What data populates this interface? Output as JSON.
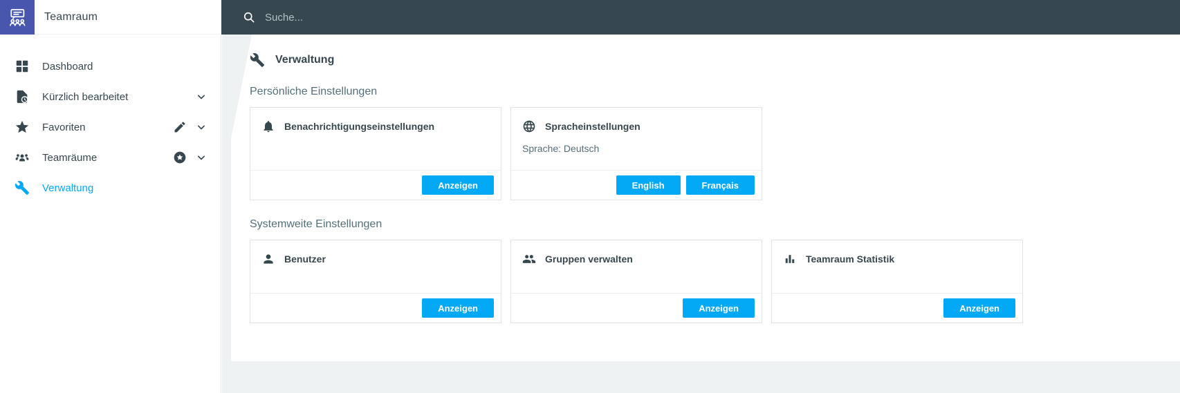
{
  "brand": {
    "title": "Teamraum",
    "logo_icon": "teamraum-logo-icon",
    "logo_color": "#4956ad"
  },
  "topbar": {
    "search_placeholder": "Suche...",
    "search_icon": "search-icon",
    "background": "#37474f"
  },
  "sidebar": {
    "items": [
      {
        "id": "dashboard",
        "label": "Dashboard",
        "icon": "dashboard-icon",
        "active": false,
        "trailing": []
      },
      {
        "id": "kuerzlich-bearbeitet",
        "label": "Kürzlich bearbeitet",
        "icon": "recent-document-icon",
        "active": false,
        "trailing": [
          "chevron-down-icon"
        ]
      },
      {
        "id": "favoriten",
        "label": "Favoriten",
        "icon": "star-icon",
        "active": false,
        "trailing": [
          "pencil-icon",
          "chevron-down-icon"
        ]
      },
      {
        "id": "teamraeume",
        "label": "Teamräume",
        "icon": "people-group-icon",
        "active": false,
        "trailing": [
          "star-circle-icon",
          "chevron-down-icon"
        ]
      },
      {
        "id": "verwaltung",
        "label": "Verwaltung",
        "icon": "wrench-icon",
        "active": true,
        "trailing": []
      }
    ]
  },
  "main": {
    "title": "Verwaltung",
    "title_icon": "wrench-icon",
    "sections": [
      {
        "heading": "Persönliche Einstellungen",
        "cards": [
          {
            "id": "benachrichtigungseinstellungen",
            "icon": "bell-icon",
            "title": "Benachrichtigungseinstellungen",
            "body": "",
            "buttons": [
              {
                "id": "anzeigen",
                "label": "Anzeigen"
              }
            ]
          },
          {
            "id": "spracheinstellungen",
            "icon": "globe-icon",
            "title": "Spracheinstellungen",
            "body": "Sprache: Deutsch",
            "buttons": [
              {
                "id": "english",
                "label": "English"
              },
              {
                "id": "francais",
                "label": "Français"
              }
            ]
          }
        ]
      },
      {
        "heading": "Systemweite Einstellungen",
        "cards": [
          {
            "id": "benutzer",
            "icon": "person-icon",
            "title": "Benutzer",
            "body": "",
            "buttons": [
              {
                "id": "anzeigen",
                "label": "Anzeigen"
              }
            ]
          },
          {
            "id": "gruppen-verwalten",
            "icon": "people-icon",
            "title": "Gruppen verwalten",
            "body": "",
            "buttons": [
              {
                "id": "anzeigen",
                "label": "Anzeigen"
              }
            ]
          },
          {
            "id": "teamraum-statistik",
            "icon": "bar-chart-icon",
            "title": "Teamraum Statistik",
            "body": "",
            "buttons": [
              {
                "id": "anzeigen",
                "label": "Anzeigen"
              }
            ]
          }
        ]
      }
    ]
  },
  "colors": {
    "accent": "#03a9f4",
    "topbar": "#37474f",
    "logo": "#4956ad",
    "text_primary": "#37474f",
    "text_secondary": "#546e7a",
    "content_bg": "#eef1f2"
  }
}
